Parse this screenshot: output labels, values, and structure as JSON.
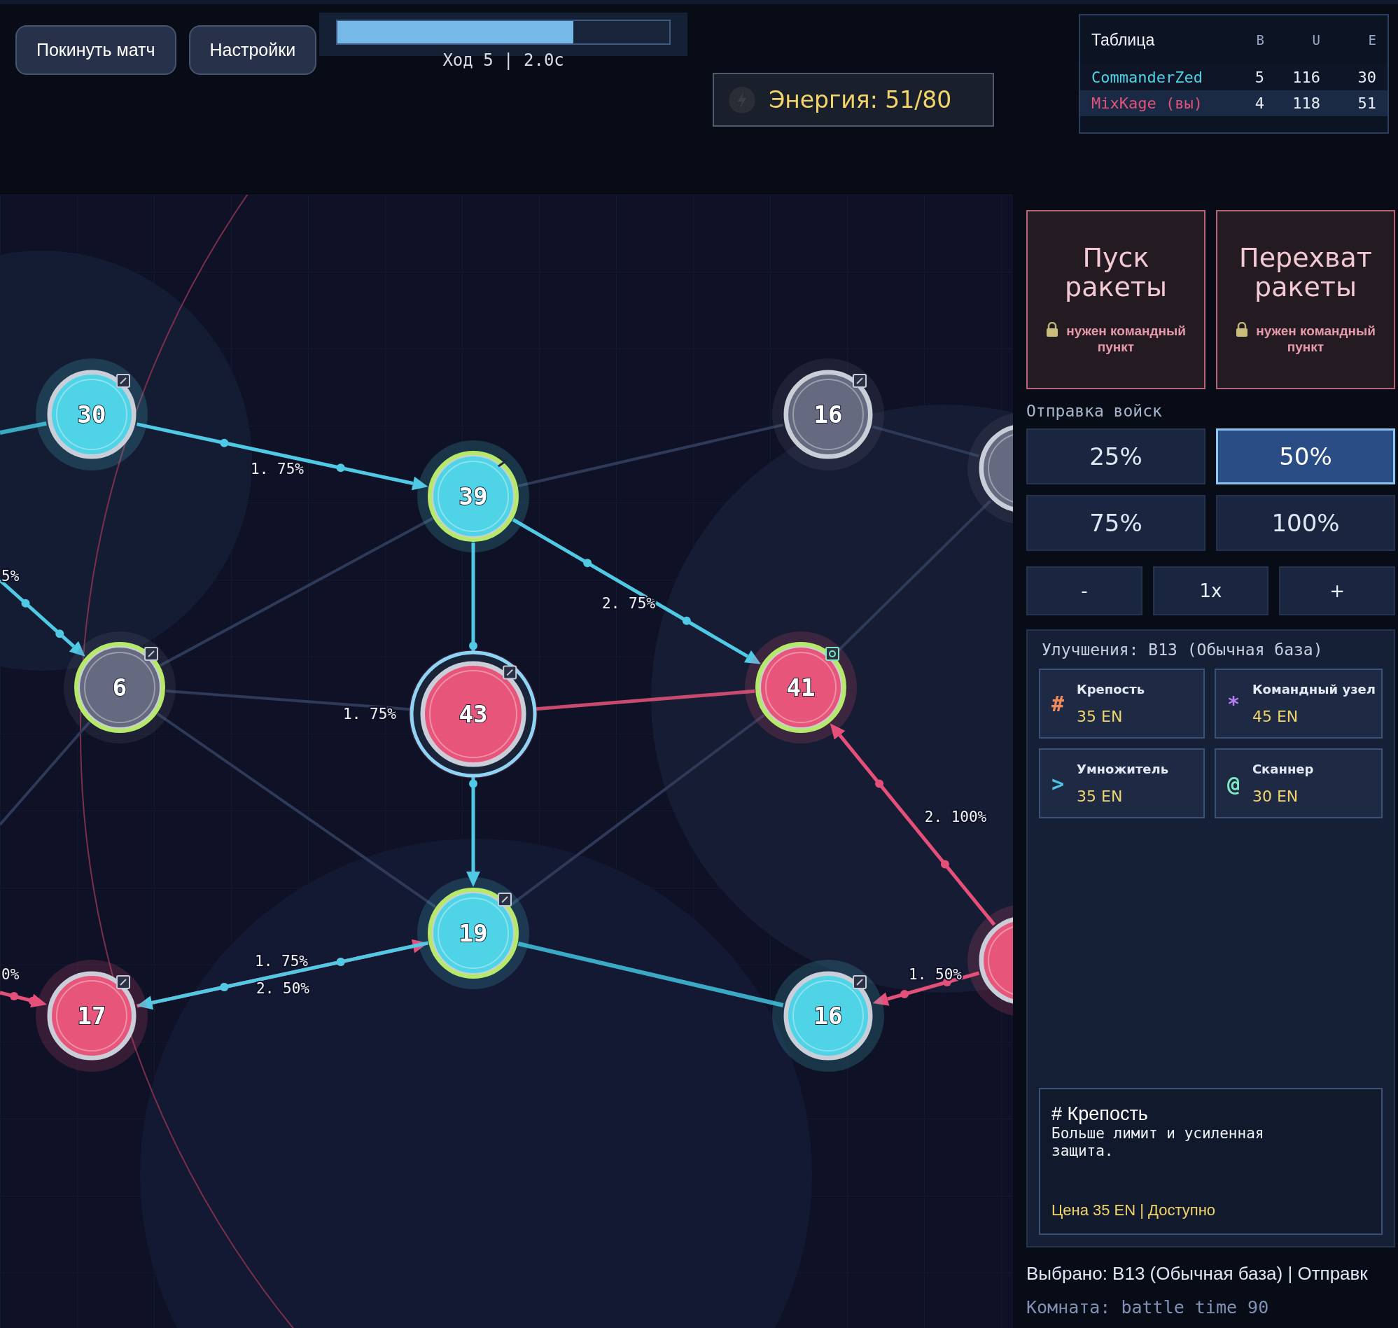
{
  "header": {
    "buttons": [
      {
        "label": "Покинуть матч"
      },
      {
        "label": "Настройки"
      }
    ],
    "turn_timer": {
      "level": 0.71,
      "label": "Ход 5 | 2.0с"
    },
    "energy": {
      "label": "Энергия: 51/80"
    }
  },
  "scoreboard": {
    "title": "Таблица",
    "columns": [
      "B",
      "U",
      "E"
    ],
    "rows": [
      {
        "name": "CommanderZed",
        "color": "#4fd3e6",
        "values": [
          "5",
          "116",
          "30"
        ],
        "highlighted": false
      },
      {
        "name": "MixKage (вы)",
        "color": "#e2527b",
        "values": [
          "4",
          "118",
          "51"
        ],
        "highlighted": true
      }
    ]
  },
  "map": {
    "nodes": [
      {
        "value": "30",
        "color": "#4fd3e6",
        "outlined": false,
        "selected": false
      },
      {
        "value": "39",
        "color": "#4fd3e6",
        "outlined": true,
        "selected": false
      },
      {
        "value": "16",
        "color": "#656a80",
        "outlined": false,
        "selected": false
      },
      {
        "value": "6",
        "color": "#656a80",
        "outlined": true,
        "selected": false
      },
      {
        "value": "43",
        "color": "#e8557a",
        "outlined": false,
        "selected": true
      },
      {
        "value": "41",
        "color": "#e8557a",
        "outlined": true,
        "selected": false
      },
      {
        "value": "19",
        "color": "#4fd3e6",
        "outlined": true,
        "selected": false
      },
      {
        "value": "17",
        "color": "#e8557a",
        "outlined": false,
        "selected": false
      },
      {
        "value": "16",
        "color": "#4fd3e6",
        "outlined": false,
        "selected": false
      },
      {
        "color": "#656a80",
        "outlined": false,
        "selected": false
      },
      {
        "color": "#e8557a",
        "outlined": false,
        "selected": false
      }
    ],
    "links": [
      {
        "kind": "link_opponent"
      },
      {
        "kind": "flow_opponent",
        "label": "1. 75%"
      },
      {
        "kind": "link"
      },
      {
        "kind": "link"
      },
      {
        "kind": "link"
      },
      {
        "kind": "flow_opponent",
        "label": "1. 75%"
      },
      {
        "kind": "flow_opponent",
        "label": "2. 75%"
      },
      {
        "kind": "link"
      },
      {
        "kind": "link_you"
      },
      {
        "kind": "link"
      },
      {
        "kind": "link"
      },
      {
        "kind": "link"
      },
      {
        "kind": "link"
      },
      {
        "kind": "flow_opponent",
        "label": "5%"
      },
      {
        "kind": "link_opponent"
      },
      {
        "kind": "flow_you",
        "label": "1. 75%"
      },
      {
        "kind": "flow_opponent",
        "label": "2. 50%"
      },
      {
        "kind": "flow_you",
        "label": "2. 100%"
      },
      {
        "kind": "flow_you",
        "label": "1. 50%"
      },
      {
        "kind": "flow_you",
        "label": "0%"
      }
    ]
  },
  "panel": {
    "missiles": [
      {
        "title": "Пуск ракеты",
        "note": "нужен командный пункт",
        "locked": true
      },
      {
        "title": "Перехват ракеты",
        "note": "нужен командный пункт",
        "locked": true
      }
    ],
    "troops_title": "Отправка войск",
    "percent_options": [
      {
        "label": "25%",
        "selected": false
      },
      {
        "label": "50%",
        "selected": true
      },
      {
        "label": "75%",
        "selected": false
      },
      {
        "label": "100%",
        "selected": false
      }
    ],
    "multiplier": [
      "-",
      "1x",
      "+"
    ],
    "upgrades": {
      "title": "Улучшения: B13 (Обычная база)",
      "items": [
        {
          "icon": "#",
          "color": "#f08a5d",
          "name": "Крепость",
          "cost": "35 EN"
        },
        {
          "icon": "*",
          "color": "#b67cf0",
          "name": "Командный узел",
          "cost": "45 EN"
        },
        {
          "icon": ">",
          "color": "#4fc3e6",
          "name": "Умножитель",
          "cost": "35 EN"
        },
        {
          "icon": "@",
          "color": "#7ee8c0",
          "name": "Сканнер",
          "cost": "30 EN"
        }
      ],
      "info": {
        "title": "# Крепость",
        "description": "Больше лимит и усиленная защита.",
        "price": "Цена 35 EN | Доступно"
      }
    },
    "status": "Выбрано: B13 (Обычная база) | Отправк",
    "room": "Комната: battle time 90"
  }
}
